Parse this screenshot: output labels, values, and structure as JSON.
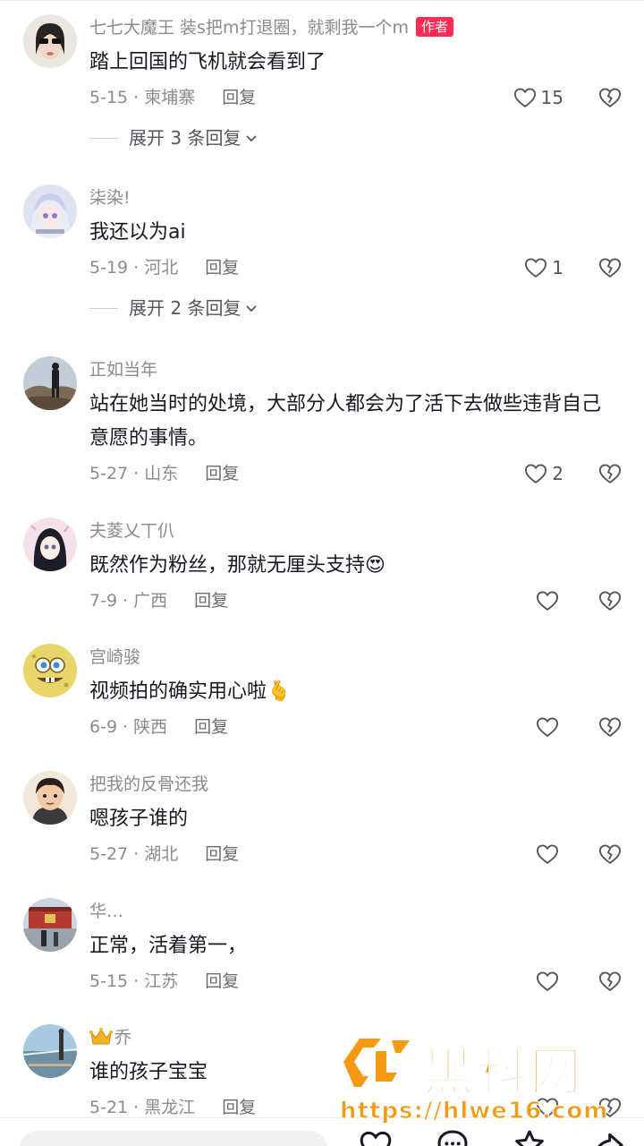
{
  "comments": [
    {
      "username": "七七大魔王 装s把m打退圈，就剩我一个m",
      "badge": "作者",
      "text": "踏上回国的飞机就会看到了",
      "date": "5-15 · 柬埔寨",
      "reply": "回复",
      "likes": "15",
      "expand": "展开 3 条回复",
      "avatar_color": "#e9e2dc"
    },
    {
      "username": "柒染!",
      "text": "我还以为ai",
      "date": "5-19 · 河北",
      "reply": "回复",
      "likes": "1",
      "expand": "展开 2 条回复",
      "avatar_color": "#d8dff0"
    },
    {
      "username": "正如当年",
      "text": "站在她当时的处境，大部分人都会为了活下去做些违背自己意愿的事情。",
      "date": "5-27 · 山东",
      "reply": "回复",
      "likes": "2",
      "avatar_color": "#b9c4cf"
    },
    {
      "username": "夫菱乂丅仈",
      "text": "既然作为粉丝，那就无厘头支持😍",
      "date": "7-9 · 广西",
      "reply": "回复",
      "likes": "",
      "avatar_color": "#f3dbe6"
    },
    {
      "username": "宫崎骏",
      "text": "视频拍的确实用心啦🫰",
      "date": "6-9 · 陕西",
      "reply": "回复",
      "likes": "",
      "avatar_color": "#e9d66b"
    },
    {
      "username": "把我的反骨还我",
      "text": "嗯孩子谁的",
      "date": "5-27 · 湖北",
      "reply": "回复",
      "likes": "",
      "avatar_color": "#f1e4d6"
    },
    {
      "username": "华…",
      "text": "正常，活着第一，",
      "date": "5-15 · 江苏",
      "reply": "回复",
      "likes": "",
      "avatar_color": "#c6d3e4"
    },
    {
      "username": "乔",
      "text": "谁的孩子宝宝",
      "date": "5-21 · 黑龙江",
      "reply": "回复",
      "likes": "",
      "avatar_color": "#a9c7dc"
    }
  ],
  "watermark": {
    "title": "黑料网",
    "url": "https://hlwe16.com"
  },
  "colors": {
    "accent": "#fe2c55",
    "watermark": "#f39a12"
  }
}
